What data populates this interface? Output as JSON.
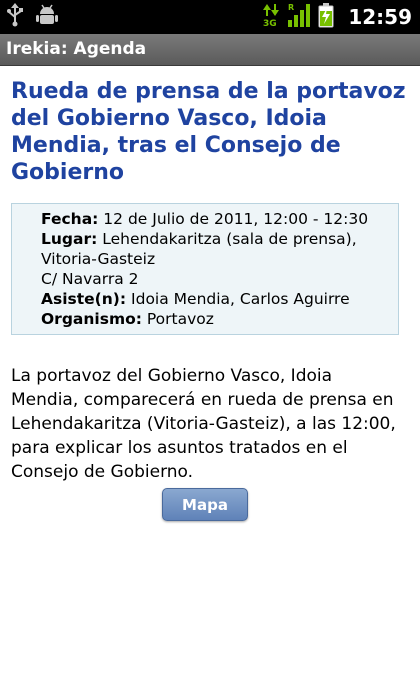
{
  "status_bar": {
    "time": "12:59",
    "network_label": "3G",
    "icons": [
      "usb-icon",
      "android-debug-icon",
      "data-transfer-icon",
      "signal-strength-icon",
      "battery-charging-icon"
    ],
    "colors": {
      "background": "#000000",
      "green": "#78c000"
    }
  },
  "app_bar": {
    "title": "Irekia: Agenda"
  },
  "event": {
    "title_lines": [
      "Rueda de prensa de la portavoz",
      "del Gobierno Vasco, Idoia",
      "Mendia, tras el Consejo de",
      "Gobierno"
    ],
    "fecha_label": "Fecha:",
    "fecha_value": "12 de Julio de 2011, 12:00 - 12:30",
    "lugar_label": "Lugar:",
    "lugar_value_1": "Lehendakaritza (sala de prensa),",
    "lugar_value_2": "Vitoria-Gasteiz",
    "lugar_value_3": "C/ Navarra 2",
    "asiste_label": "Asiste(n):",
    "asiste_value": "Idoia Mendia, Carlos Aguirre",
    "organismo_label": "Organismo:",
    "organismo_value": "Portavoz",
    "description_lines": [
      "La portavoz del Gobierno Vasco, Idoia",
      "Mendia, comparecerá en rueda de prensa en",
      "Lehendakaritza (Vitoria-Gasteiz), a las 12:00,",
      "para explicar los asuntos tratados en el",
      "Consejo de Gobierno."
    ]
  },
  "actions": {
    "map_button": "Mapa"
  },
  "colors": {
    "title": "#1f43a0",
    "info_background": "#eef5f8",
    "button": "#6f8fc4"
  }
}
